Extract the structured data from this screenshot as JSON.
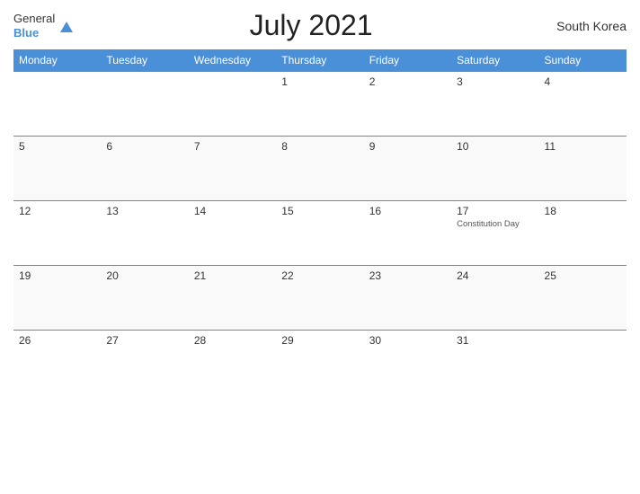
{
  "header": {
    "logo_general": "General",
    "logo_blue": "Blue",
    "month_title": "July 2021",
    "country": "South Korea"
  },
  "weekdays": [
    "Monday",
    "Tuesday",
    "Wednesday",
    "Thursday",
    "Friday",
    "Saturday",
    "Sunday"
  ],
  "weeks": [
    [
      {
        "date": "",
        "holiday": ""
      },
      {
        "date": "",
        "holiday": ""
      },
      {
        "date": "",
        "holiday": ""
      },
      {
        "date": "1",
        "holiday": ""
      },
      {
        "date": "2",
        "holiday": ""
      },
      {
        "date": "3",
        "holiday": ""
      },
      {
        "date": "4",
        "holiday": ""
      }
    ],
    [
      {
        "date": "5",
        "holiday": ""
      },
      {
        "date": "6",
        "holiday": ""
      },
      {
        "date": "7",
        "holiday": ""
      },
      {
        "date": "8",
        "holiday": ""
      },
      {
        "date": "9",
        "holiday": ""
      },
      {
        "date": "10",
        "holiday": ""
      },
      {
        "date": "11",
        "holiday": ""
      }
    ],
    [
      {
        "date": "12",
        "holiday": ""
      },
      {
        "date": "13",
        "holiday": ""
      },
      {
        "date": "14",
        "holiday": ""
      },
      {
        "date": "15",
        "holiday": ""
      },
      {
        "date": "16",
        "holiday": ""
      },
      {
        "date": "17",
        "holiday": "Constitution Day"
      },
      {
        "date": "18",
        "holiday": ""
      }
    ],
    [
      {
        "date": "19",
        "holiday": ""
      },
      {
        "date": "20",
        "holiday": ""
      },
      {
        "date": "21",
        "holiday": ""
      },
      {
        "date": "22",
        "holiday": ""
      },
      {
        "date": "23",
        "holiday": ""
      },
      {
        "date": "24",
        "holiday": ""
      },
      {
        "date": "25",
        "holiday": ""
      }
    ],
    [
      {
        "date": "26",
        "holiday": ""
      },
      {
        "date": "27",
        "holiday": ""
      },
      {
        "date": "28",
        "holiday": ""
      },
      {
        "date": "29",
        "holiday": ""
      },
      {
        "date": "30",
        "holiday": ""
      },
      {
        "date": "31",
        "holiday": ""
      },
      {
        "date": "",
        "holiday": ""
      }
    ]
  ]
}
